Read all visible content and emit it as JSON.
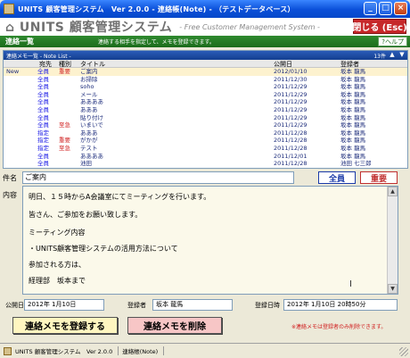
{
  "window": {
    "title": "UNITS 顧客管理システム　Ver 2.0.0 - 連絡帳(Note) - （テストデータベース）",
    "buttons": [
      "_",
      "□",
      "×"
    ]
  },
  "header": {
    "logo": "UNITS 顧客管理システム",
    "subtitle": "- Free Customer Management System -",
    "close_label": "閉じる (Esc)"
  },
  "section": {
    "title": "連絡一覧",
    "instruction": "連絡する相手を指定して、メモを登録できます。",
    "help_label": "ヘルプ"
  },
  "list": {
    "header": "連絡メモ一覧 - Note List -",
    "count": "13件",
    "columns": [
      "宛先",
      "種別",
      "タイトル",
      "公開日",
      "登録者"
    ],
    "rows": [
      {
        "mark": "New",
        "to": "全員",
        "type": "重要",
        "title": "ご案内",
        "date": "2012/01/10",
        "author": "坂本 龍馬"
      },
      {
        "mark": "",
        "to": "全員",
        "type": "",
        "title": "お掃除",
        "date": "2011/12/30",
        "author": "坂本 龍馬"
      },
      {
        "mark": "",
        "to": "全員",
        "type": "",
        "title": "soho",
        "date": "2011/12/29",
        "author": "坂本 龍馬"
      },
      {
        "mark": "",
        "to": "全員",
        "type": "",
        "title": "メール",
        "date": "2011/12/29",
        "author": "坂本 龍馬"
      },
      {
        "mark": "",
        "to": "全員",
        "type": "",
        "title": "ああああ",
        "date": "2011/12/29",
        "author": "坂本 龍馬"
      },
      {
        "mark": "",
        "to": "全員",
        "type": "",
        "title": "あああ",
        "date": "2011/12/29",
        "author": "坂本 龍馬"
      },
      {
        "mark": "",
        "to": "全員",
        "type": "",
        "title": "貼り付け",
        "date": "2011/12/29",
        "author": "坂本 龍馬"
      },
      {
        "mark": "",
        "to": "全員",
        "type": "至急",
        "title": "いまいで",
        "date": "2011/12/29",
        "author": "坂本 龍馬"
      },
      {
        "mark": "",
        "to": "指定",
        "type": "",
        "title": "あああ",
        "date": "2011/12/28",
        "author": "坂本 龍馬"
      },
      {
        "mark": "",
        "to": "指定",
        "type": "重要",
        "title": "がかが",
        "date": "2011/12/28",
        "author": "坂本 龍馬"
      },
      {
        "mark": "",
        "to": "指定",
        "type": "至急",
        "title": "テスト",
        "date": "2011/12/28",
        "author": "坂本 龍馬"
      },
      {
        "mark": "",
        "to": "全員",
        "type": "",
        "title": "ああああ",
        "date": "2011/12/01",
        "author": "坂本 龍馬"
      },
      {
        "mark": "",
        "to": "全員",
        "type": "",
        "title": "池田",
        "date": "2011/12/28",
        "author": "池田 七三郎"
      }
    ]
  },
  "subject": {
    "label": "件名",
    "value": "ご案内",
    "recipient_label": "全員",
    "priority_label": "重要"
  },
  "content": {
    "label": "内容",
    "lines": [
      "明日、１５時からA会議室にてミーティングを行います。",
      "皆さん、ご参加をお願い致します。",
      "ミーティング内容",
      "・UNITS顧客管理システムの活用方法について",
      "参加される方は、",
      "経理部　坂本まで"
    ]
  },
  "meta": {
    "publish_label": "公開日",
    "publish_value": "2012年 1月10日",
    "registrant_label": "登録者",
    "registrant_value": "坂本 龍馬",
    "datetime_label": "登録日時",
    "datetime_value": "2012年 1月10日 20時50分"
  },
  "actions": {
    "register": "連絡メモを登録する",
    "delete": "連絡メモを削除",
    "warning": "※連絡メモは登録者のみ削除できます。"
  },
  "status": {
    "app": "UNITS 顧客管理システム　Ver 2.0.0",
    "module": "連絡帳(Note)"
  },
  "colors": {
    "title_bar": "#0a4fd8",
    "section_bar": "#1b6b1b",
    "close_button": "#c6282a",
    "link_blue": "#1a1ae6",
    "alert_red": "#d02020"
  }
}
